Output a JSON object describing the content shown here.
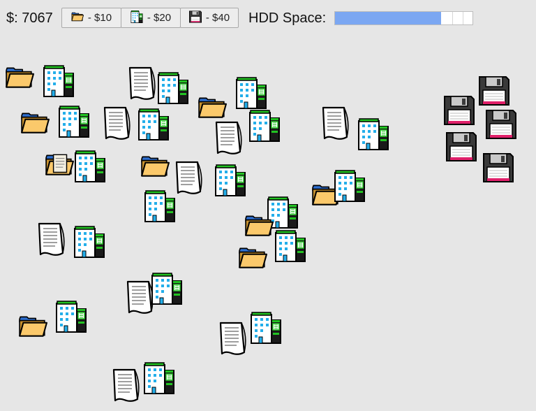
{
  "money": {
    "text": "$: 7067"
  },
  "shop": [
    {
      "id": "folder",
      "label": "- $10"
    },
    {
      "id": "building",
      "label": "- $20"
    },
    {
      "id": "floppy",
      "label": "- $40"
    }
  ],
  "hdd": {
    "label": "HDD Space:",
    "fill_fraction": 0.77
  },
  "colors": {
    "background": "#e6e6e6",
    "hdd_fill": "#7ba7f2",
    "folder": "#f9c96a",
    "building_roof": "#22c322"
  },
  "icons": {
    "folder": "folder-icon",
    "building": "building-icon",
    "document": "document-icon",
    "floppy": "floppy-disk-icon",
    "scroll": "scroll-icon"
  },
  "sprite_counts": {
    "folders": 9,
    "buildings": 18,
    "documents": 9,
    "floppy_disks": 5
  }
}
